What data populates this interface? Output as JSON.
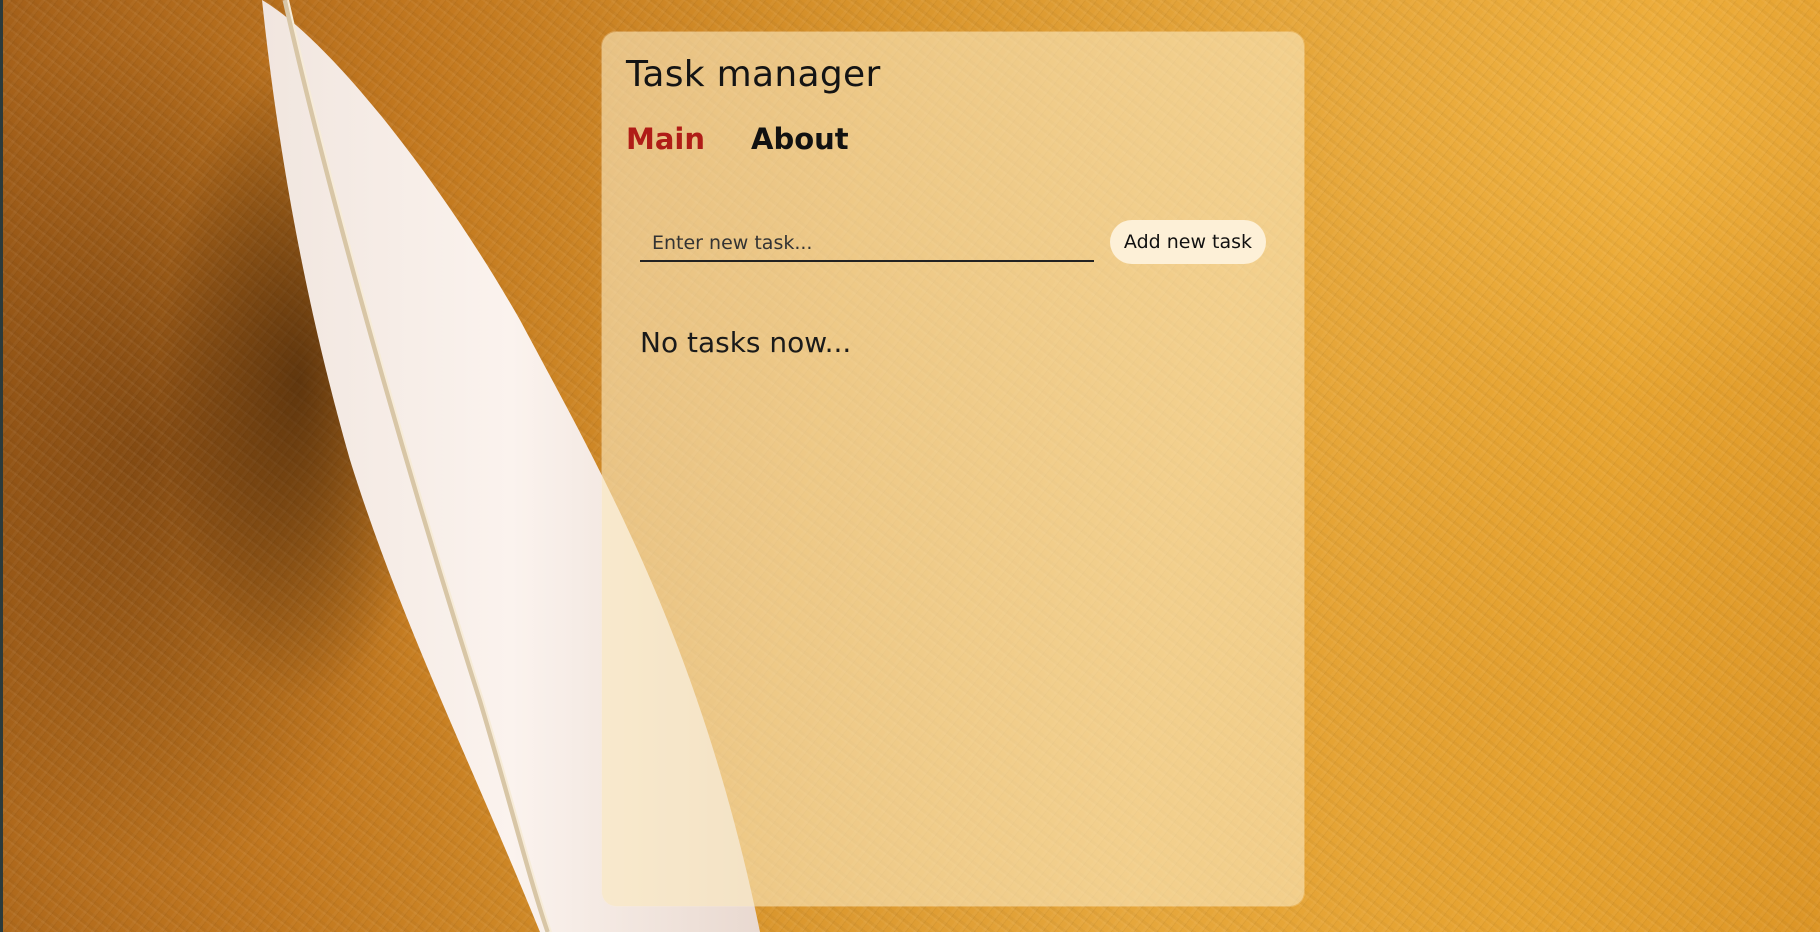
{
  "app": {
    "title": "Task manager"
  },
  "nav": {
    "items": [
      {
        "label": "Main",
        "active": true
      },
      {
        "label": "About",
        "active": false
      }
    ]
  },
  "task_form": {
    "input_placeholder": "Enter new task...",
    "input_value": "",
    "add_button_label": "Add new task"
  },
  "task_list": {
    "empty_message": "No tasks now..."
  },
  "colors": {
    "active_nav": "#b01c17",
    "panel": "#fae8be",
    "button": "#fdf0d7"
  }
}
